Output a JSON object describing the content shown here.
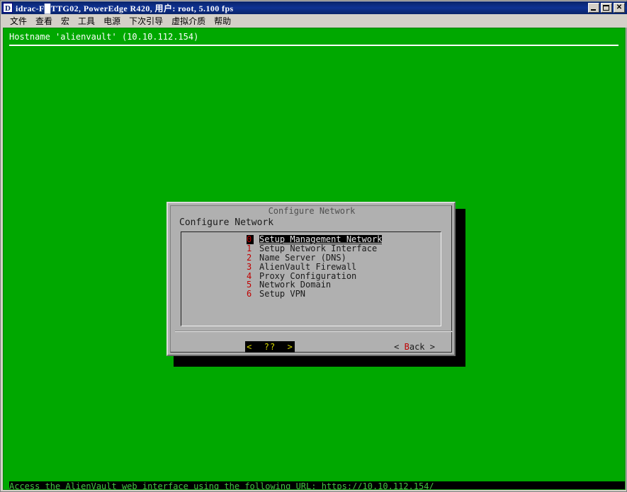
{
  "window": {
    "icon": "idrac-app-icon",
    "icon_letter": "D",
    "title": "idrac-F█TTG02, PowerEdge R420, 用户:  root, 5.100 fps",
    "controls": {
      "minimize": "minimize-button",
      "maximize": "maximize-button",
      "close_label": "✕"
    }
  },
  "menubar": {
    "items": [
      {
        "label": "文件"
      },
      {
        "label": "查看"
      },
      {
        "label": "宏"
      },
      {
        "label": "工具"
      },
      {
        "label": "电源"
      },
      {
        "label": "下次引导"
      },
      {
        "label": "虚拟介质"
      },
      {
        "label": "帮助"
      }
    ]
  },
  "console": {
    "hostname_line": "Hostname 'alienvault' (10.10.112.154)",
    "bottom_status": "Access the AlienVault web interface using the following URL: https://10.10.112.154/",
    "background_color": "#00a800",
    "text_color": "#ffffff"
  },
  "dialog": {
    "window_title": "Configure Network",
    "heading": "Configure Network",
    "menu": {
      "items": [
        {
          "num": "0",
          "label": "Setup Management Network",
          "selected": true
        },
        {
          "num": "1",
          "label": "Setup Network Interface",
          "selected": false
        },
        {
          "num": "2",
          "label": "Name Server (DNS)",
          "selected": false
        },
        {
          "num": "3",
          "label": "AlienVault Firewall",
          "selected": false
        },
        {
          "num": "4",
          "label": "Proxy Configuration",
          "selected": false
        },
        {
          "num": "5",
          "label": "Network Domain",
          "selected": false
        },
        {
          "num": "6",
          "label": "Setup VPN",
          "selected": false
        }
      ]
    },
    "buttons": {
      "primary": {
        "label": "<  ??  >",
        "active": true,
        "color": "#d8d800"
      },
      "back": {
        "prefix": "< ",
        "hotkey": "B",
        "rest": "ack >",
        "active": false,
        "hotkey_color": "#c00000"
      }
    }
  }
}
